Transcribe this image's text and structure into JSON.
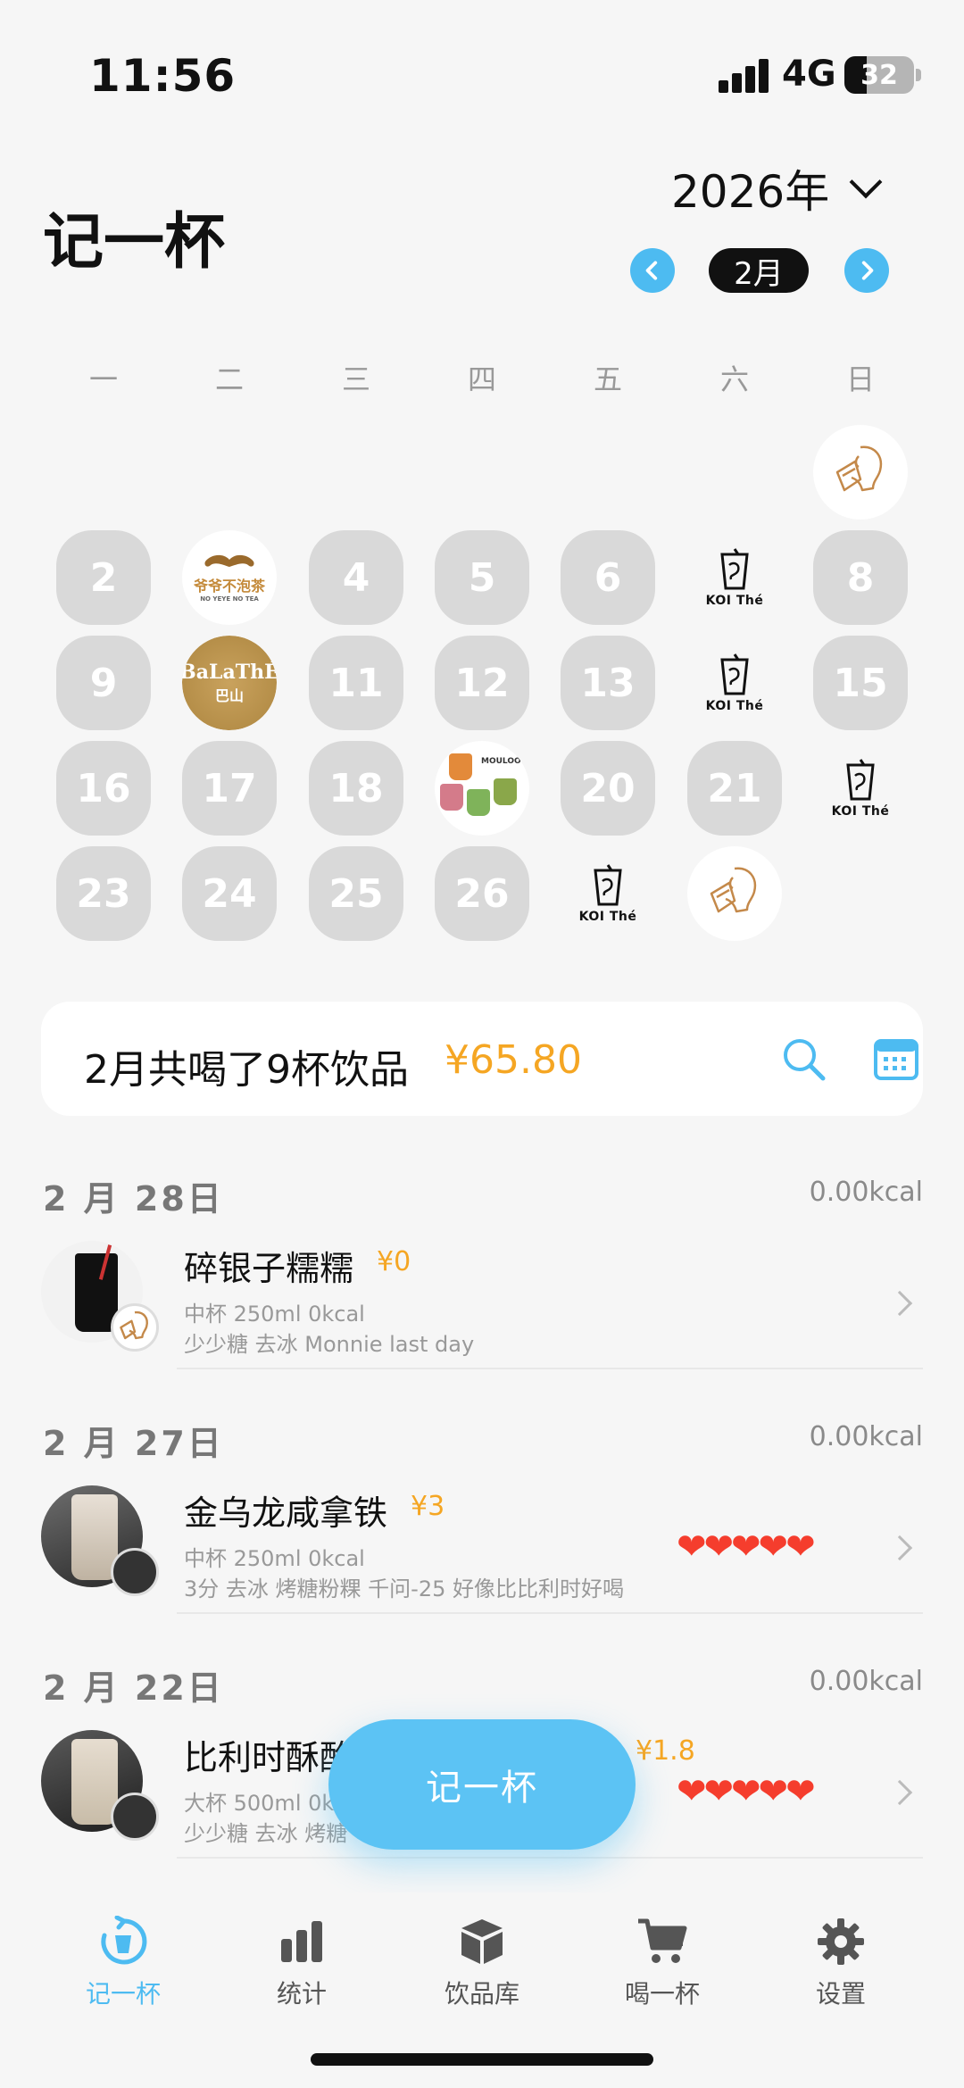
{
  "status": {
    "time": "11:56",
    "network": "4G",
    "battery": "32",
    "battery_level": 0.32
  },
  "header": {
    "title": "记一杯",
    "year": "2026年",
    "month": "2月"
  },
  "calendar": {
    "weekdays": [
      "一",
      "二",
      "三",
      "四",
      "五",
      "六",
      "日"
    ],
    "days": [
      "2",
      "4",
      "5",
      "6",
      "8",
      "9",
      "11",
      "12",
      "13",
      "15",
      "16",
      "17",
      "18",
      "20",
      "21",
      "23",
      "24",
      "25",
      "26"
    ],
    "logos": {
      "koi": "KOI Thé",
      "yeye": "爷爷不泡茶",
      "yeye_sub": "NO YEYE NO TEA",
      "balathe": "BaLaThÉ",
      "balathe_sub": "巴山",
      "moulo": "MOULOO"
    }
  },
  "summary": {
    "text": "2月共喝了9杯饮品",
    "amount": "¥65.80"
  },
  "entries": [
    {
      "date": "2 月 28日",
      "kcal": "0.00kcal",
      "name": "碎银子糯糯",
      "price": "¥0",
      "meta1": "中杯 250ml  0kcal",
      "meta2": "少少糖  去冰  Monnie last day",
      "rating": ""
    },
    {
      "date": "2 月 27日",
      "kcal": "0.00kcal",
      "name": "金乌龙咸拿铁",
      "price": "¥3",
      "meta1": "中杯 250ml  0kcal",
      "meta2": "3分  去冰  烤糖粉粿  千问-25 好像比比利时好喝",
      "rating": "❤❤❤❤❤"
    },
    {
      "date": "2 月 22日",
      "kcal": "0.00kcal",
      "name": "比利时酥酪",
      "price": "¥1.8",
      "meta1": "大杯 500ml  0k",
      "meta2": "少少糖  去冰  烤糖",
      "rating": "❤❤❤❤❤"
    }
  ],
  "fab": {
    "label": "记一杯"
  },
  "tabs": [
    {
      "label": "记一杯",
      "icon": "cup-refresh-icon"
    },
    {
      "label": "统计",
      "icon": "bar-chart-icon"
    },
    {
      "label": "饮品库",
      "icon": "box-icon"
    },
    {
      "label": "喝一杯",
      "icon": "cart-icon"
    },
    {
      "label": "设置",
      "icon": "gear-icon"
    }
  ],
  "colors": {
    "accent": "#4dbbf1",
    "price": "#f5a623",
    "heart": "#f53d2d"
  }
}
